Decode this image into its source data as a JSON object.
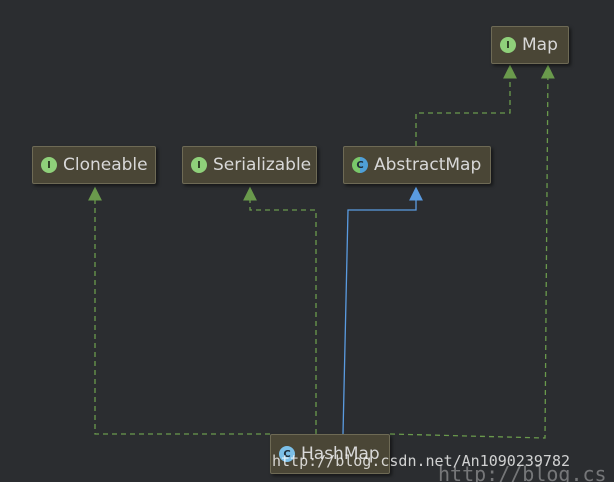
{
  "nodes": {
    "map": {
      "label": "Map",
      "badge": "I",
      "kind": "interface"
    },
    "cloneable": {
      "label": "Cloneable",
      "badge": "I",
      "kind": "interface"
    },
    "serializable": {
      "label": "Serializable",
      "badge": "I",
      "kind": "interface"
    },
    "abstract_map": {
      "label": "AbstractMap",
      "badge": "C",
      "kind": "abstract-class"
    },
    "hash_map": {
      "label": "HashMap",
      "badge": "C",
      "kind": "class"
    }
  },
  "colors": {
    "background": "#2b2d30",
    "implements_edge": "#6a9a4c",
    "extends_edge": "#5a9be0",
    "node_fill": "#4a4636"
  },
  "edges": [
    {
      "from": "HashMap",
      "to": "Cloneable",
      "relation": "implements"
    },
    {
      "from": "HashMap",
      "to": "Serializable",
      "relation": "implements"
    },
    {
      "from": "HashMap",
      "to": "AbstractMap",
      "relation": "extends"
    },
    {
      "from": "HashMap",
      "to": "Map",
      "relation": "implements"
    },
    {
      "from": "AbstractMap",
      "to": "Map",
      "relation": "implements"
    }
  ],
  "watermark": {
    "text1": "http://blog.csdn.net/An1090239782",
    "text2": "http://blog.cs"
  }
}
